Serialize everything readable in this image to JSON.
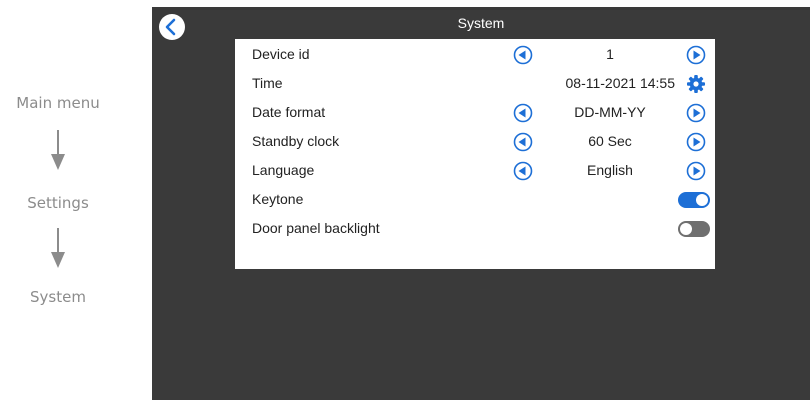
{
  "breadcrumb": {
    "items": [
      "Main menu",
      "Settings",
      "System"
    ]
  },
  "screen": {
    "title": "System",
    "back_icon": "chevron-left-icon"
  },
  "settings": {
    "device_id": {
      "label": "Device id",
      "value": "1"
    },
    "time": {
      "label": "Time",
      "value": "08-11-2021 14:55",
      "icon": "gear-icon"
    },
    "date_format": {
      "label": "Date format",
      "value": "DD-MM-YY"
    },
    "standby_clock": {
      "label": "Standby clock",
      "value": "60 Sec"
    },
    "language": {
      "label": "Language",
      "value": "English"
    },
    "keytone": {
      "label": "Keytone",
      "enabled": true
    },
    "door_panel_backlight": {
      "label": "Door panel backlight",
      "enabled": false
    }
  },
  "colors": {
    "screen_bg": "#3a3a3a",
    "accent": "#1d6fd6",
    "toggle_off": "#6f6f6f",
    "breadcrumb_text": "#8c8c8c"
  }
}
